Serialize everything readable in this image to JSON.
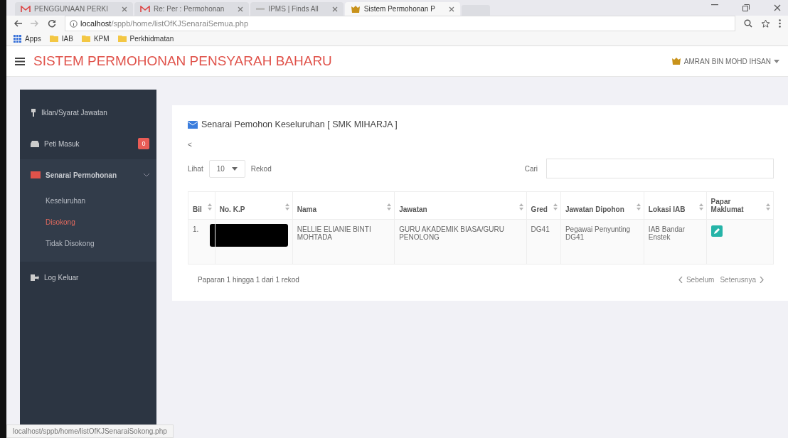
{
  "browser": {
    "tabs": [
      {
        "label": "PENGGUNAAN PERKI",
        "selected": false
      },
      {
        "label": "Re: Per : Permohonan",
        "selected": false
      },
      {
        "label": "IPMS | Finds All",
        "selected": false
      },
      {
        "label": "Sistem Permohonan P",
        "selected": true
      }
    ],
    "address": {
      "host": "localhost",
      "path": "/sppb/home/listOfKJSenaraiSemua.php"
    },
    "bookmarks": [
      {
        "label": "Apps",
        "kind": "apps"
      },
      {
        "label": "IAB",
        "kind": "folder"
      },
      {
        "label": "KPM",
        "kind": "folder"
      },
      {
        "label": "Perkhidmatan",
        "kind": "folder"
      }
    ]
  },
  "header": {
    "title": "SISTEM PERMOHONAN PENSYARAH BAHARU",
    "user": "AMRAN BIN MOHD IHSAN"
  },
  "sidebar": {
    "items": [
      {
        "label": "Iklan/Syarat Jawatan",
        "expanded": false
      },
      {
        "label": "Peti Masuk",
        "badge": "0",
        "expanded": false
      },
      {
        "label": "Senarai Permohonan",
        "expanded": true,
        "children": [
          {
            "label": "Keseluruhan",
            "selected": false
          },
          {
            "label": "Disokong",
            "selected": true
          },
          {
            "label": "Tidak Disokong",
            "selected": false
          }
        ]
      },
      {
        "label": "Log Keluar",
        "expanded": false
      }
    ]
  },
  "panel": {
    "title": "Senarai Pemohon Keseluruhan [ SMK MIHARJA ]",
    "back": "<",
    "length": {
      "before": "Lihat",
      "value": "10",
      "after": "Rekod"
    },
    "search": {
      "label": "Cari"
    },
    "table": {
      "columns": [
        "Bil",
        "No. K.P",
        "Nama",
        "Jawatan",
        "Gred",
        "Jawatan Dipohon",
        "Lokasi IAB",
        "Papar Maklumat"
      ],
      "rows": [
        {
          "bil": "1.",
          "redacted": true,
          "nama": "NELLIE ELIANIE BINTI MOHTADA",
          "jawatan": "GURU AKADEMIK BIASA/GURU PENOLONG",
          "gred": "DG41",
          "dipohon": "Pegawai Penyunting DG41",
          "lokasi": "IAB Bandar Enstek"
        }
      ]
    },
    "info": "Paparan 1 hingga 1 dari 1 rekod",
    "pager": {
      "prev": "Sebelum",
      "next": "Seterusnya"
    }
  },
  "status_bar": "localhost/sppb/home/listOfKJSenaraiSokong.php"
}
